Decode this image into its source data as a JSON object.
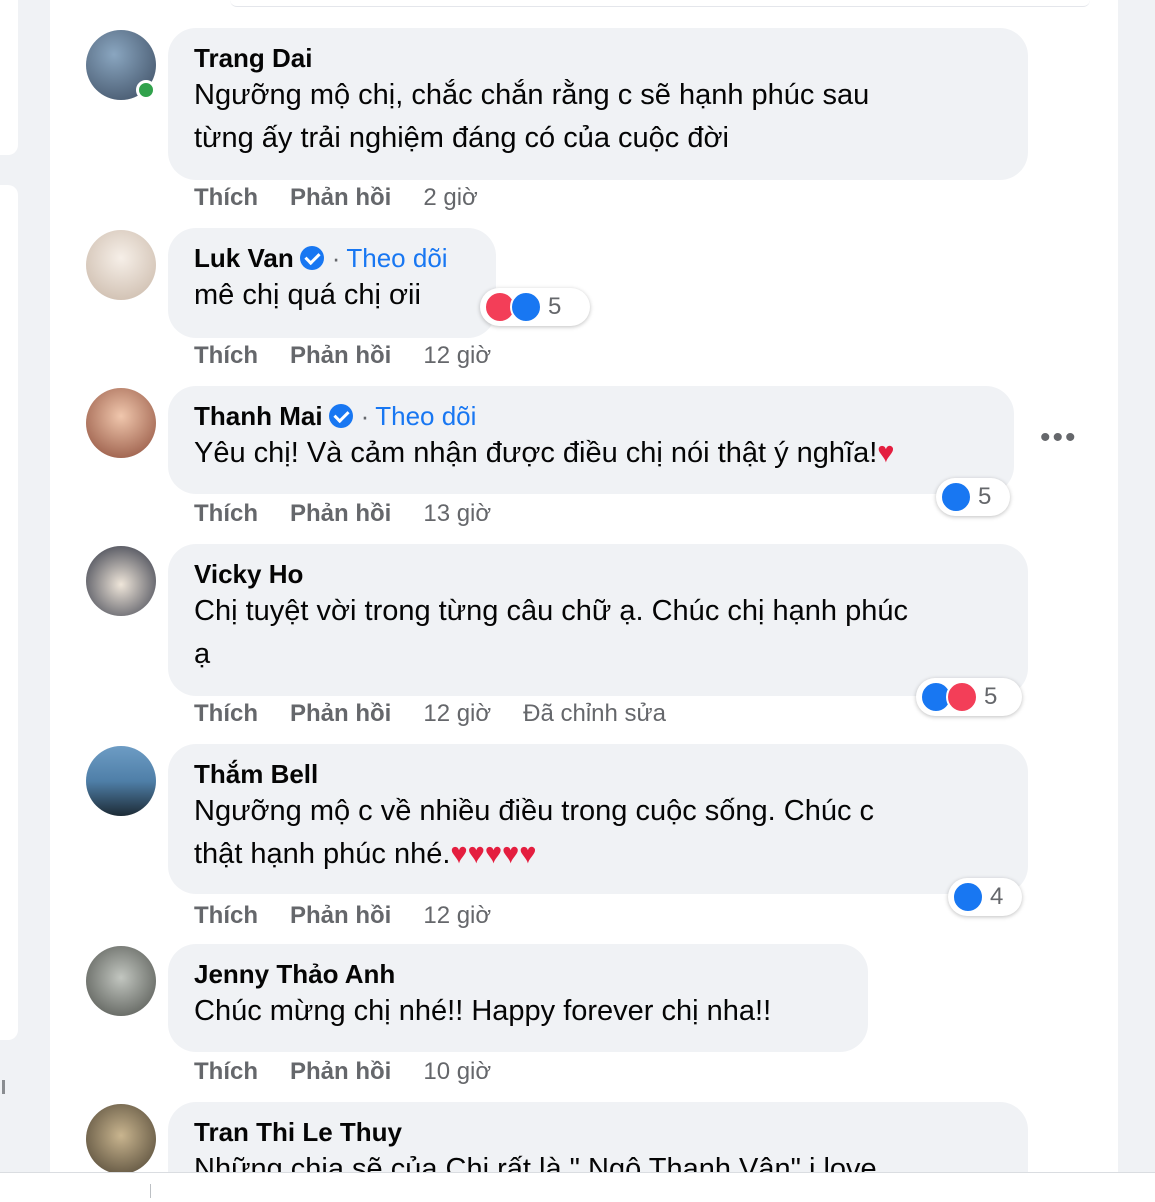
{
  "comments": [
    {
      "author": "Trang Dai",
      "text_lines": [
        "Ngưỡng mộ chị, chắc chắn rằng c sẽ hạnh phúc sau",
        "từng ấy trải nghiệm đáng có của cuộc đời"
      ],
      "verified": false,
      "follow": "",
      "like": "Thích",
      "reply": "Phản hồi",
      "time": "2 giờ",
      "edited": "",
      "reactions": [],
      "reaction_count": "",
      "avatar_colors": [
        "#6d8fae",
        "#3a4a5f"
      ],
      "online": true
    },
    {
      "author": "Luk Van",
      "text_lines": [
        "mê chị quá chị ơii"
      ],
      "verified": true,
      "follow": "Theo dõi",
      "like": "Thích",
      "reply": "Phản hồi",
      "time": "12 giờ",
      "edited": "",
      "reactions": [
        "love",
        "like"
      ],
      "reaction_count": "5",
      "avatar_colors": [
        "#f3ece6",
        "#c8b6a6"
      ]
    },
    {
      "author": "Thanh Mai",
      "text_lines": [
        "Yêu chị! Và cảm nhận được điều chị nói thật ý nghĩa!"
      ],
      "verified": true,
      "follow": "Theo dõi",
      "like": "Thích",
      "reply": "Phản hồi",
      "time": "13 giờ",
      "edited": "",
      "reactions": [
        "like"
      ],
      "reaction_count": "5",
      "avatar_colors": [
        "#e9b79a",
        "#8c4b38"
      ]
    },
    {
      "author": "Vicky Ho",
      "text_lines": [
        "Chị tuyệt vời trong từng câu chữ ạ. Chúc chị hạnh phúc",
        "ạ"
      ],
      "verified": false,
      "follow": "",
      "like": "Thích",
      "reply": "Phản hồi",
      "time": "12 giờ",
      "edited": "Đã chỉnh sửa",
      "reactions": [
        "like",
        "love"
      ],
      "reaction_count": "5",
      "avatar_colors": [
        "#e8ddd0",
        "#2b3040"
      ]
    },
    {
      "author": "Thắm Bell",
      "text_lines": [
        "Ngưỡng mộ c về nhiều điều trong cuộc sống. Chúc c",
        "thật hạnh phúc nhé."
      ],
      "verified": false,
      "follow": "",
      "like": "Thích",
      "reply": "Phản hồi",
      "time": "12 giờ",
      "edited": "",
      "reactions": [
        "like"
      ],
      "reaction_count": "4",
      "avatar_colors": [
        "#4f7fa8",
        "#1d2b36"
      ]
    },
    {
      "author": "Jenny Thảo Anh",
      "text_lines": [
        "Chúc mừng chị nhé!! Happy forever chị nha!!"
      ],
      "verified": false,
      "follow": "",
      "like": "Thích",
      "reply": "Phản hồi",
      "time": "10 giờ",
      "edited": "",
      "reactions": [],
      "reaction_count": "",
      "avatar_colors": [
        "#9aa09a",
        "#4c4f4a"
      ]
    },
    {
      "author": "Tran Thi Le Thuy",
      "text_lines": [
        "Những chia sẽ của Chị rất là \" Ngô Thanh Vân\" i love"
      ],
      "verified": false,
      "follow": "",
      "like": "",
      "reply": "",
      "time": "",
      "edited": "",
      "reactions": [],
      "reaction_count": "",
      "avatar_colors": [
        "#9c8a6a",
        "#4a4030"
      ]
    }
  ],
  "more_menu": "•••",
  "colors": {
    "accent": "#1877f2",
    "love": "#f33e58",
    "heart": "#e41e3f",
    "bubble": "#f0f2f5",
    "muted": "#65676b"
  }
}
